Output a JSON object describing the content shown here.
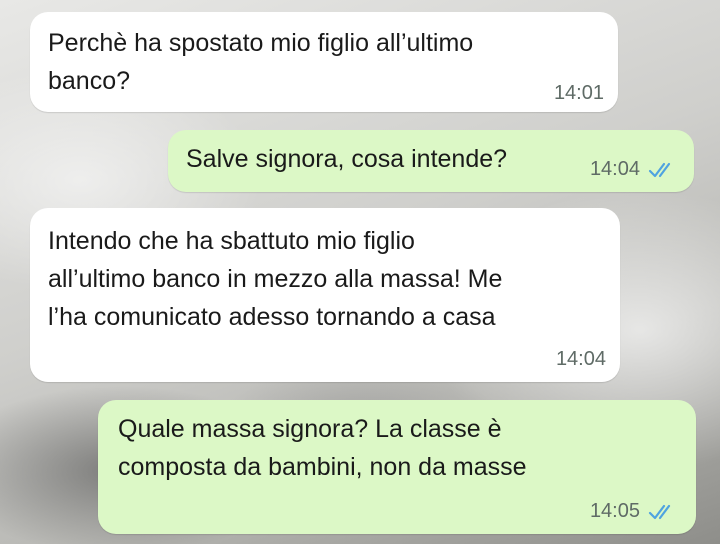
{
  "chat": {
    "messages": [
      {
        "direction": "incoming",
        "lines": [
          "Perchè ha spostato mio figlio all’ultimo",
          "banco?"
        ],
        "time": "14:01"
      },
      {
        "direction": "outgoing",
        "lines": [
          "Salve signora, cosa intende?"
        ],
        "time": "14:04",
        "status_icon": "double-check-icon"
      },
      {
        "direction": "incoming",
        "lines": [
          "Intendo che ha sbattuto mio figlio",
          "all’ultimo banco in mezzo alla massa! Me",
          "l’ha comunicato adesso tornando a casa"
        ],
        "time": "14:04"
      },
      {
        "direction": "outgoing",
        "lines": [
          "Quale massa signora? La classe è",
          "composta da bambini, non da masse"
        ],
        "time": "14:05",
        "status_icon": "double-check-icon"
      }
    ]
  },
  "colors": {
    "incoming_bubble": "#ffffff",
    "outgoing_bubble": "#dcf8c6",
    "read_ticks": "#4fa3e0"
  }
}
